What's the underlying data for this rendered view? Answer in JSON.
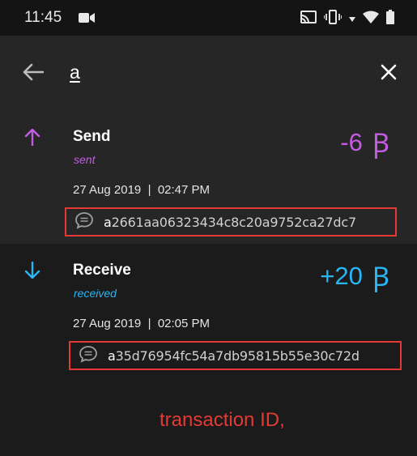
{
  "status_bar": {
    "time": "11:45"
  },
  "search": {
    "query": "a"
  },
  "transactions": [
    {
      "title": "Send",
      "status": "sent",
      "amount": "-6",
      "currency_symbol": "Ꞵ",
      "date_time": "27 Aug 2019  |  02:47 PM",
      "tx_id_prefix": "a",
      "tx_id_rest": "2661aa06323434c8c20a9752ca27dc7",
      "color": "#c45ce3"
    },
    {
      "title": "Receive",
      "status": "received",
      "amount": "+20",
      "currency_symbol": "Ꞵ",
      "date_time": "27 Aug 2019  |  02:05 PM",
      "tx_id_prefix": "a",
      "tx_id_rest": "35d76954fc54a7db95815b55e30c72d",
      "color": "#29b6f6"
    }
  ],
  "annotation": {
    "text": "transaction ID,"
  },
  "colors": {
    "background": "#1b1b1b",
    "panel": "#262626",
    "send_accent": "#c45ce3",
    "receive_accent": "#29b6f6",
    "highlight": "#e53935"
  }
}
